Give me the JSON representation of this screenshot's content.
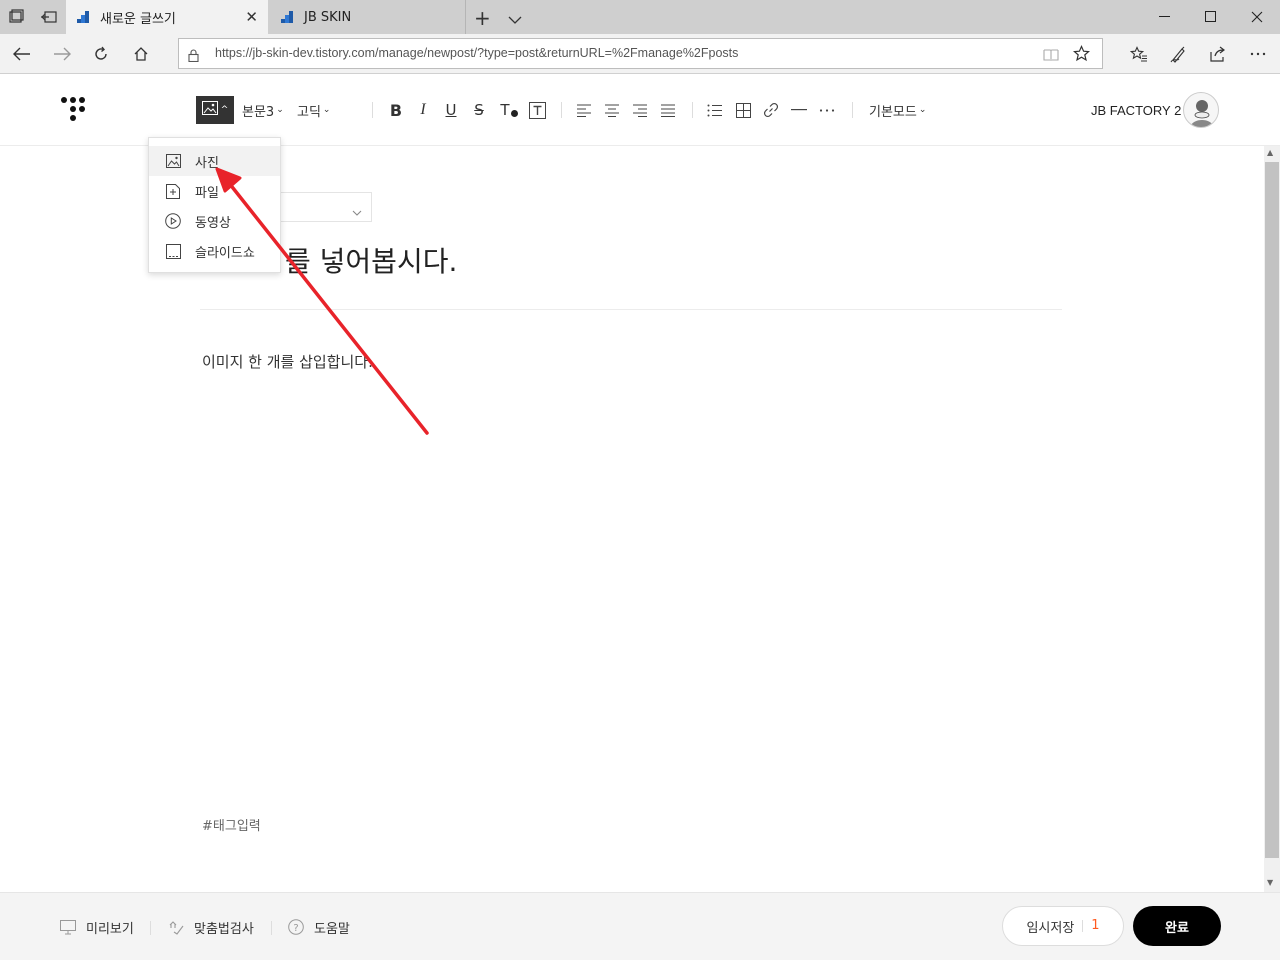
{
  "browser": {
    "tabs": [
      {
        "title": "새로운 글쓰기",
        "active": true
      },
      {
        "title": "JB SKIN",
        "active": false
      }
    ],
    "url": "https://jb-skin-dev.tistory.com/manage/newpost/?type=post&returnURL=%2Fmanage%2Fposts"
  },
  "toolbar": {
    "style_label": "본문3",
    "font_label": "고딕",
    "mode_label": "기본모드",
    "blog_name": "JB FACTORY 2"
  },
  "media_menu": {
    "items": [
      {
        "label": "사진",
        "icon": "image-icon"
      },
      {
        "label": "파일",
        "icon": "file-add-icon"
      },
      {
        "label": "동영상",
        "icon": "video-play-icon"
      },
      {
        "label": "슬라이드쇼",
        "icon": "slideshow-icon"
      }
    ]
  },
  "editor": {
    "title_visible": "를 넣어봅시다.",
    "body": "이미지 한 개를 삽입합니다.",
    "tag_placeholder": "#태그입력"
  },
  "bottom": {
    "preview_label": "미리보기",
    "spellcheck_label": "맞춤법검사",
    "help_label": "도움말",
    "save_label": "임시저장",
    "save_count": "1",
    "done_label": "완료"
  },
  "colors": {
    "annotation_arrow": "#e8232a",
    "accent_count": "#ff5a1f"
  }
}
